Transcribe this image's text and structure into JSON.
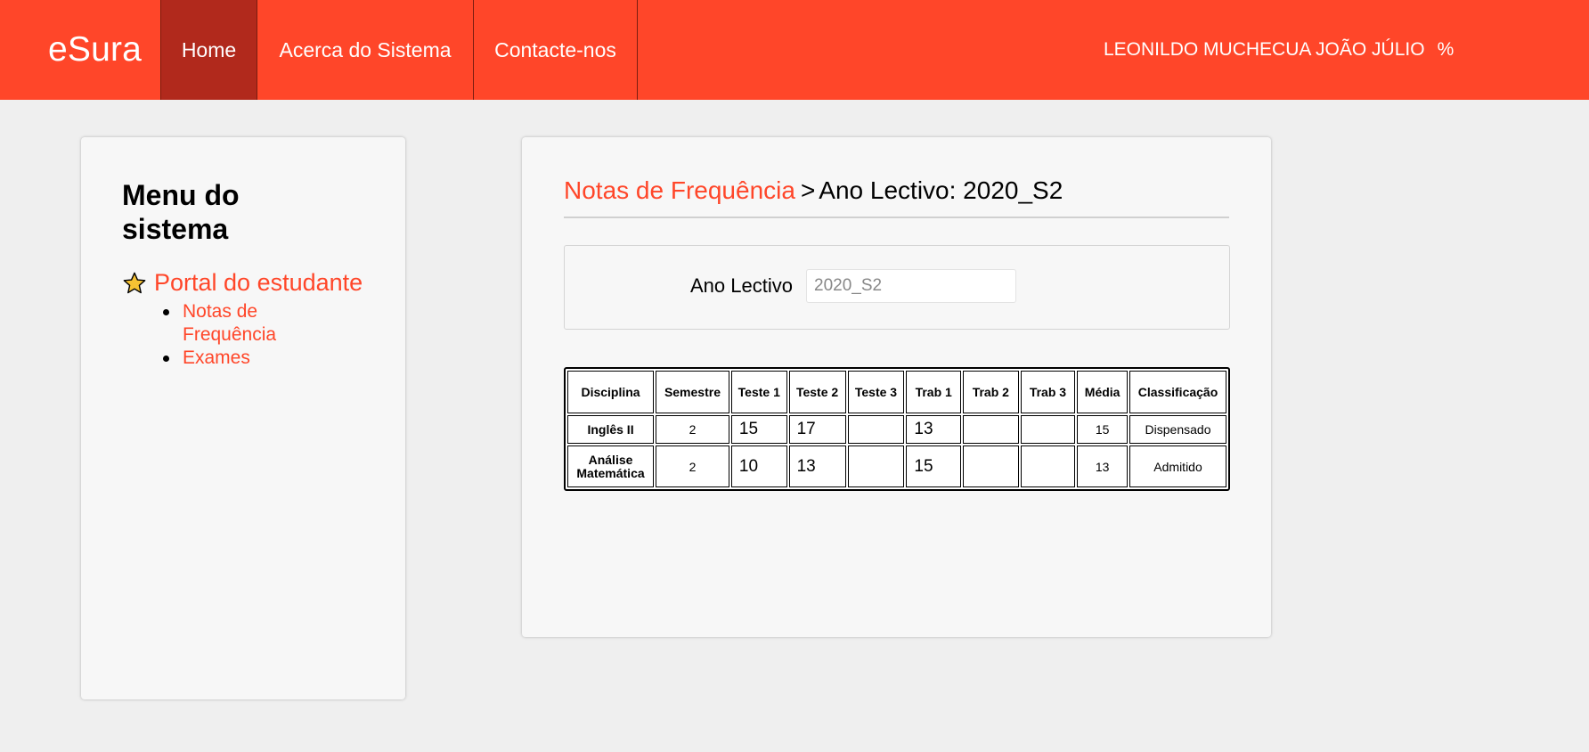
{
  "header": {
    "brand": "eSura",
    "nav": [
      {
        "label": "Home",
        "active": true
      },
      {
        "label": "Acerca do Sistema",
        "active": false
      },
      {
        "label": "Contacte-nos",
        "active": false
      }
    ],
    "user_name": "LEONILDO MUCHECUA JOÃO JÚLIO",
    "user_suffix": "%"
  },
  "sidebar": {
    "title": "Menu do sistema",
    "portal_label": "Portal do estudante",
    "portal_icon": "star-icon",
    "items": [
      {
        "label": "Notas de Frequência"
      },
      {
        "label": "Exames"
      }
    ]
  },
  "main": {
    "breadcrumb_link": "Notas de Frequência",
    "breadcrumb_sep": ">",
    "breadcrumb_text": "Ano Lectivo: 2020_S2",
    "filter_label": "Ano Lectivo",
    "filter_placeholder": "2020_S2",
    "table": {
      "headers": [
        "Disciplina",
        "Semestre",
        "Teste 1",
        "Teste 2",
        "Teste 3",
        "Trab 1",
        "Trab 2",
        "Trab 3",
        "Média",
        "Classificação"
      ],
      "rows": [
        [
          "Inglês II",
          "2",
          "15",
          "17",
          "",
          "13",
          "",
          "",
          "15",
          "Dispensado"
        ],
        [
          "Análise Matemática",
          "2",
          "10",
          "13",
          "",
          "15",
          "",
          "",
          "13",
          "Admitido"
        ]
      ]
    }
  },
  "colors": {
    "accent": "#ff4629",
    "nav_active": "#b1291c",
    "background": "#efefef",
    "panel": "#f7f7f7"
  }
}
